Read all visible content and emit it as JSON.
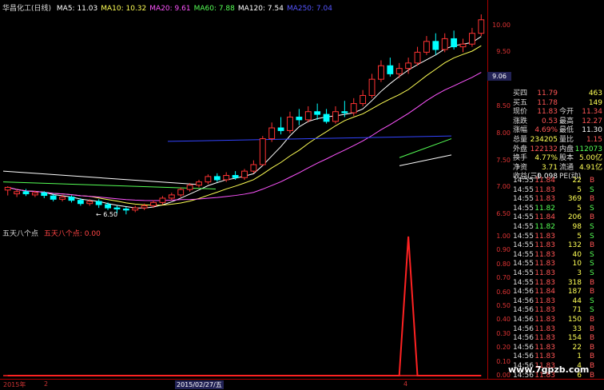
{
  "header": {
    "title": "华昌化工(日线)",
    "ma": [
      {
        "label": "MA5: 11.03",
        "color": "#ffffff"
      },
      {
        "label": "MA10: 10.32",
        "color": "#ffff55"
      },
      {
        "label": "MA20: 9.61",
        "color": "#ff55ff"
      },
      {
        "label": "MA60: 7.88",
        "color": "#55ff55"
      },
      {
        "label": "MA120: 7.54",
        "color": "#ffffff"
      },
      {
        "label": "MA250: 7.04",
        "color": "#5555ff"
      }
    ]
  },
  "indicator": {
    "name": "五天八个点",
    "value_label": "五天八个点: 0.00",
    "value": 0.0,
    "peak": 1.0
  },
  "chart_data": [
    {
      "type": "candlestick",
      "y_ticks": [
        "10.00",
        "9.50",
        "9.00",
        "8.50",
        "8.00",
        "7.50",
        "7.00",
        "6.50"
      ],
      "ylim": [
        6.4,
        10.2
      ],
      "low_label": "6.50",
      "price_marker": "9.06",
      "candles": [
        [
          6.95,
          7.0,
          6.85,
          7.02
        ],
        [
          6.88,
          6.92,
          6.82,
          6.96
        ],
        [
          6.92,
          6.88,
          6.84,
          6.97
        ],
        [
          6.86,
          6.9,
          6.82,
          6.94
        ],
        [
          6.9,
          6.85,
          6.8,
          6.93
        ],
        [
          6.84,
          6.78,
          6.74,
          6.88
        ],
        [
          6.78,
          6.82,
          6.74,
          6.86
        ],
        [
          6.82,
          6.76,
          6.72,
          6.85
        ],
        [
          6.76,
          6.7,
          6.66,
          6.8
        ],
        [
          6.7,
          6.74,
          6.66,
          6.78
        ],
        [
          6.74,
          6.68,
          6.62,
          6.78
        ],
        [
          6.68,
          6.62,
          6.58,
          6.72
        ],
        [
          6.62,
          6.6,
          6.52,
          6.66
        ],
        [
          6.6,
          6.58,
          6.5,
          6.64
        ],
        [
          6.58,
          6.62,
          6.54,
          6.66
        ],
        [
          6.62,
          6.66,
          6.58,
          6.7
        ],
        [
          6.66,
          6.72,
          6.62,
          6.76
        ],
        [
          6.72,
          6.8,
          6.68,
          6.84
        ],
        [
          6.8,
          6.86,
          6.76,
          6.9
        ],
        [
          6.86,
          6.96,
          6.82,
          7.0
        ],
        [
          6.96,
          7.04,
          6.92,
          7.08
        ],
        [
          7.04,
          7.1,
          7.0,
          7.14
        ],
        [
          7.1,
          7.2,
          7.06,
          7.24
        ],
        [
          7.2,
          7.14,
          7.1,
          7.26
        ],
        [
          7.14,
          7.22,
          7.1,
          7.28
        ],
        [
          7.22,
          7.18,
          7.14,
          7.3
        ],
        [
          7.18,
          7.3,
          7.14,
          7.34
        ],
        [
          7.3,
          7.42,
          7.26,
          7.5
        ],
        [
          7.42,
          7.9,
          7.4,
          7.95
        ],
        [
          7.9,
          8.1,
          7.84,
          8.2
        ],
        [
          8.1,
          8.05,
          7.98,
          8.3
        ],
        [
          8.05,
          8.3,
          8.0,
          8.4
        ],
        [
          8.3,
          8.25,
          8.15,
          8.45
        ],
        [
          8.25,
          8.4,
          8.2,
          8.5
        ],
        [
          8.4,
          8.35,
          8.25,
          8.55
        ],
        [
          8.35,
          8.22,
          8.18,
          8.45
        ],
        [
          8.22,
          8.4,
          8.18,
          8.5
        ],
        [
          8.4,
          8.38,
          8.3,
          8.6
        ],
        [
          8.38,
          8.55,
          8.32,
          8.65
        ],
        [
          8.55,
          8.7,
          8.5,
          8.8
        ],
        [
          8.7,
          9.0,
          8.65,
          9.1
        ],
        [
          9.0,
          9.25,
          8.95,
          9.35
        ],
        [
          9.25,
          9.1,
          9.05,
          9.4
        ],
        [
          9.1,
          9.2,
          9.02,
          9.3
        ],
        [
          9.2,
          9.3,
          9.1,
          9.4
        ],
        [
          9.3,
          9.5,
          9.25,
          9.6
        ],
        [
          9.5,
          9.7,
          9.45,
          9.8
        ],
        [
          9.7,
          9.55,
          9.45,
          9.85
        ],
        [
          9.55,
          9.75,
          9.5,
          9.85
        ],
        [
          9.75,
          9.6,
          9.55,
          9.9
        ],
        [
          9.6,
          9.65,
          9.5,
          9.75
        ],
        [
          9.65,
          9.85,
          9.6,
          9.95
        ],
        [
          9.85,
          10.1,
          9.8,
          10.2
        ]
      ]
    },
    {
      "type": "line",
      "name": "五天八个点",
      "y_ticks": [
        "1.00",
        "0.90",
        "0.80",
        "0.70",
        "0.60",
        "0.50",
        "0.40",
        "0.30",
        "0.20",
        "0.10",
        "0.00"
      ],
      "ylim": [
        0,
        1.0
      ],
      "values": [
        0,
        0,
        0,
        0,
        0,
        0,
        0,
        0,
        0,
        0,
        0,
        0,
        0,
        0,
        0,
        0,
        0,
        0,
        0,
        0,
        0,
        0,
        0,
        0,
        0,
        0,
        0,
        0,
        0,
        0,
        0,
        0,
        0,
        0,
        0,
        0,
        0,
        0,
        0,
        0,
        0,
        0,
        0,
        0,
        1,
        0,
        0,
        0,
        0,
        0,
        0,
        0,
        0
      ]
    }
  ],
  "quote": {
    "rows": [
      {
        "l": "买四",
        "v": "11.79",
        "vc": "#ff5555",
        "r": "",
        "rv": "463",
        "rvc": "#ffff55"
      },
      {
        "l": "买五",
        "v": "11.78",
        "vc": "#ff5555",
        "r": "",
        "rv": "149",
        "rvc": "#ffff55"
      },
      {
        "l": "现价",
        "v": "11.83",
        "vc": "#ff5555",
        "r": "今开",
        "rv": "11.34",
        "rvc": "#ff5555"
      },
      {
        "l": "涨跌",
        "v": "0.53",
        "vc": "#ff5555",
        "r": "最高",
        "rv": "12.27",
        "rvc": "#ff5555"
      },
      {
        "l": "涨幅",
        "v": "4.69%",
        "vc": "#ff5555",
        "r": "最低",
        "rv": "11.30",
        "rvc": "#ffffff"
      },
      {
        "l": "总量",
        "v": "234205",
        "vc": "#ffff55",
        "r": "量比",
        "rv": "1.15",
        "rvc": "#ff5555"
      },
      {
        "l": "外盘",
        "v": "122132",
        "vc": "#ff5555",
        "r": "内盘",
        "rv": "112073",
        "rvc": "#55ff55"
      },
      {
        "l": "换手",
        "v": "4.77%",
        "vc": "#ffff55",
        "r": "股本",
        "rv": "5.00亿",
        "rvc": "#ffff55"
      },
      {
        "l": "净资",
        "v": "3.71",
        "vc": "#ffff55",
        "r": "流通",
        "rv": "4.91亿",
        "rvc": "#ffff55"
      },
      {
        "l": "收益(三)",
        "v": "-0.098",
        "vc": "#ffffff",
        "r": "PE(动)",
        "rv": "",
        "rvc": "#ffff55"
      }
    ]
  },
  "trades": [
    {
      "t": "14:55",
      "p": "11.84",
      "n": "22",
      "s": "B"
    },
    {
      "t": "14:55",
      "p": "11.83",
      "n": "5",
      "s": "S"
    },
    {
      "t": "14:55",
      "p": "11.83",
      "n": "369",
      "s": "B"
    },
    {
      "t": "14:55",
      "p": "11.82",
      "n": "5",
      "s": "S"
    },
    {
      "t": "14:55",
      "p": "11.84",
      "n": "206",
      "s": "B"
    },
    {
      "t": "14:55",
      "p": "11.82",
      "n": "98",
      "s": "S"
    },
    {
      "t": "14:55",
      "p": "11.83",
      "n": "5",
      "s": "S"
    },
    {
      "t": "14:55",
      "p": "11.83",
      "n": "132",
      "s": "B"
    },
    {
      "t": "14:55",
      "p": "11.83",
      "n": "40",
      "s": "S"
    },
    {
      "t": "14:55",
      "p": "11.83",
      "n": "10",
      "s": "S"
    },
    {
      "t": "14:55",
      "p": "11.83",
      "n": "3",
      "s": "S"
    },
    {
      "t": "14:55",
      "p": "11.83",
      "n": "318",
      "s": "B"
    },
    {
      "t": "14:56",
      "p": "11.84",
      "n": "187",
      "s": "B"
    },
    {
      "t": "14:56",
      "p": "11.83",
      "n": "44",
      "s": "S"
    },
    {
      "t": "14:56",
      "p": "11.83",
      "n": "71",
      "s": "S"
    },
    {
      "t": "14:56",
      "p": "11.83",
      "n": "150",
      "s": "B"
    },
    {
      "t": "14:56",
      "p": "11.83",
      "n": "33",
      "s": "B"
    },
    {
      "t": "14:56",
      "p": "11.83",
      "n": "154",
      "s": "B"
    },
    {
      "t": "14:56",
      "p": "11.83",
      "n": "22",
      "s": "B"
    },
    {
      "t": "14:56",
      "p": "11.83",
      "n": "1",
      "s": "B"
    },
    {
      "t": "14:56",
      "p": "11.83",
      "n": "4",
      "s": "B"
    },
    {
      "t": "14:56",
      "p": "11.83",
      "n": "6",
      "s": "B"
    }
  ],
  "bottom": {
    "year": "2015年",
    "marker_left": "2",
    "date": "2015/02/27/五",
    "marker_right": "4"
  },
  "watermark": "www.7gpzb.com",
  "colors": {
    "up": "#ff3333",
    "down": "#00ffff",
    "axis": "#aa0000"
  }
}
